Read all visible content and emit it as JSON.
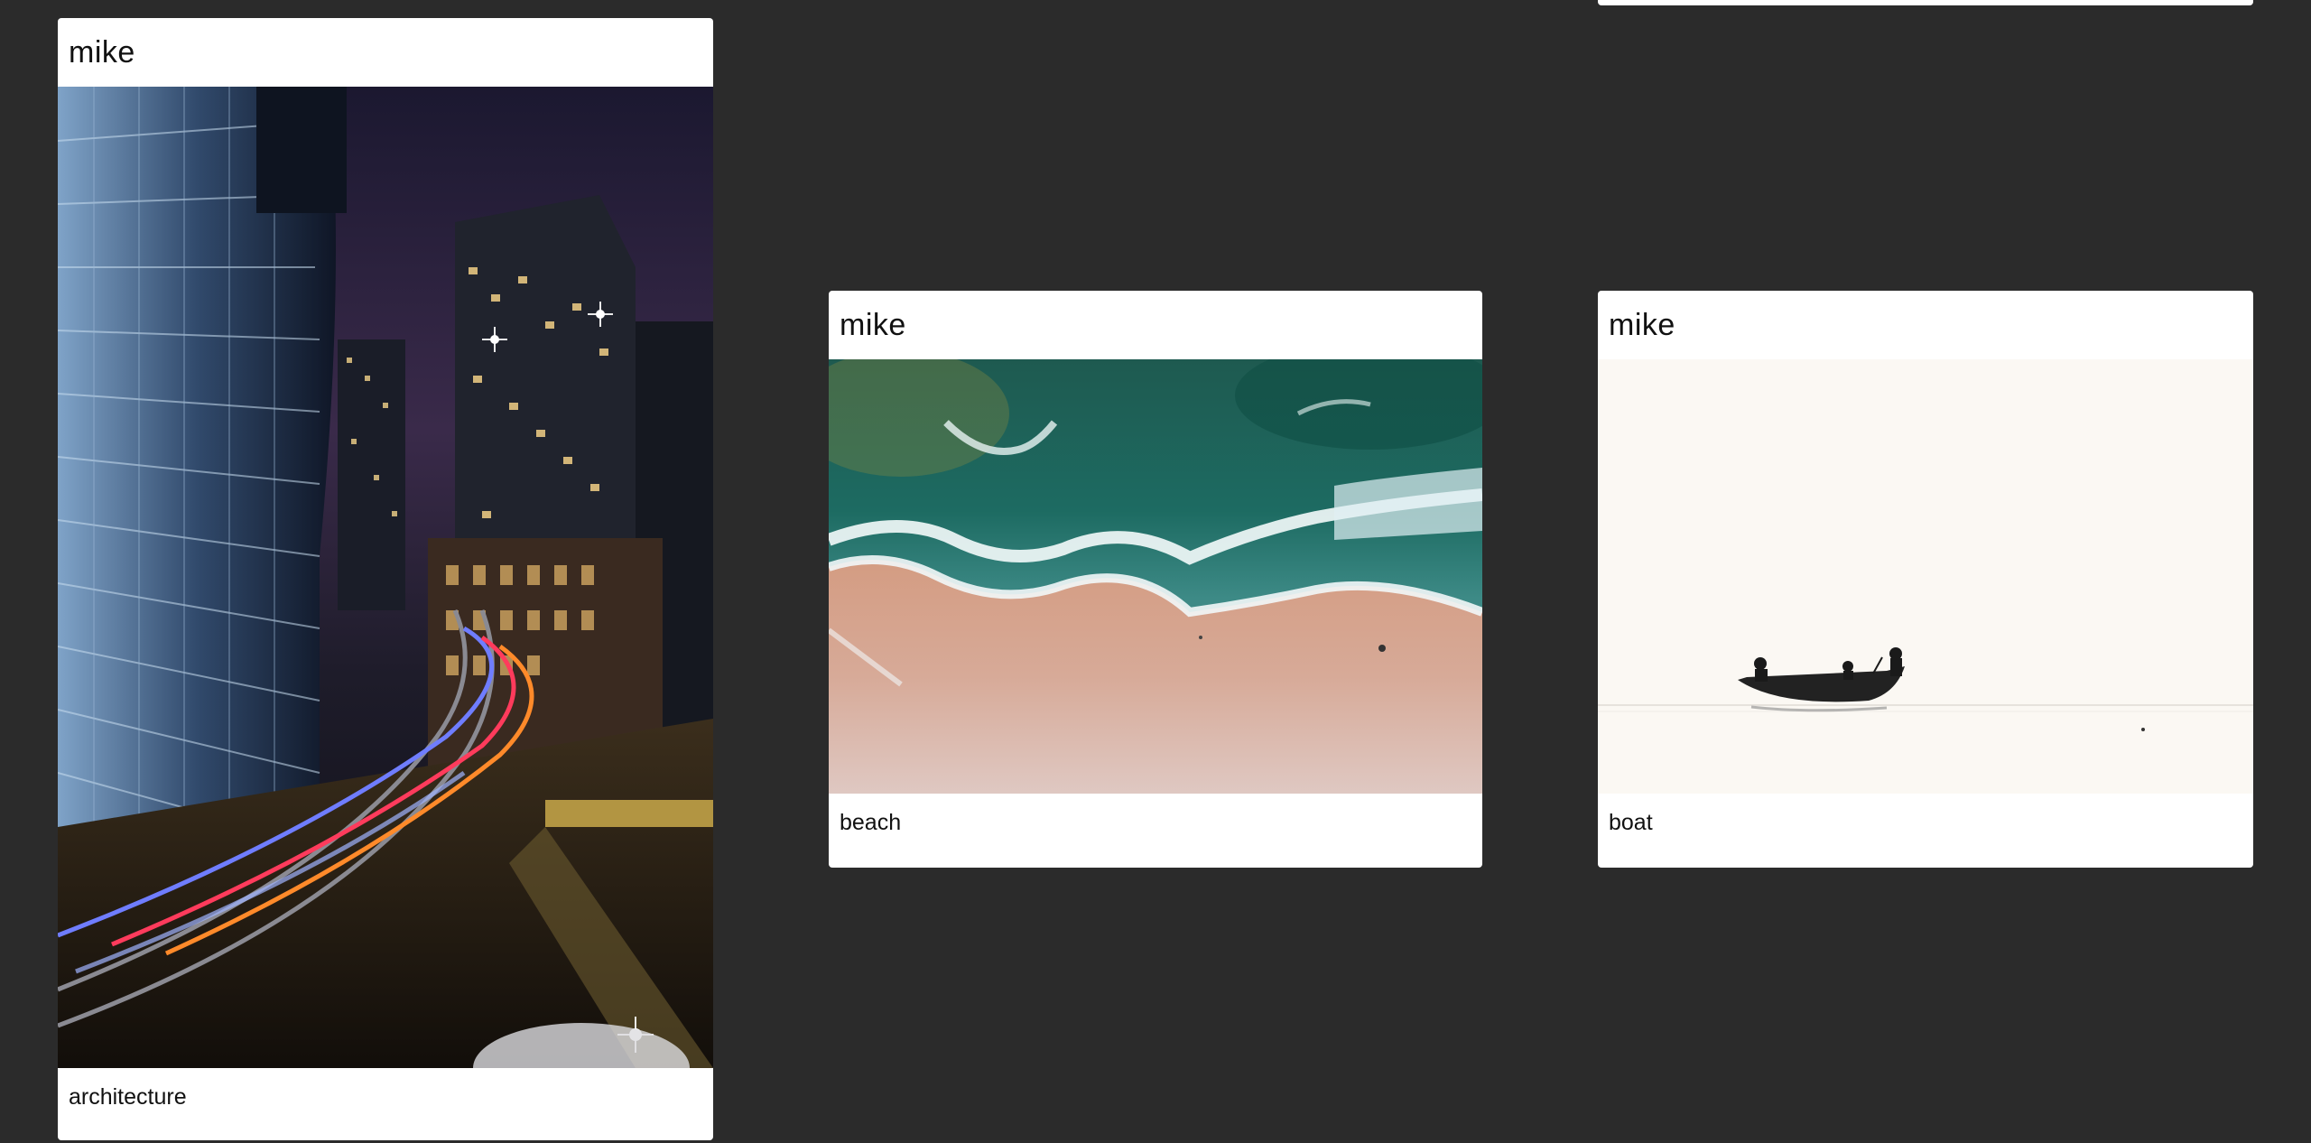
{
  "gallery": {
    "cards": [
      {
        "author": "mike",
        "caption": "architecture",
        "image": "city-night-light-trails-photo"
      },
      {
        "author": "mike",
        "caption": "beach",
        "image": "aerial-beach-waves-photo"
      },
      {
        "author": "mike",
        "caption": "boat",
        "image": "boat-minimal-photo"
      }
    ]
  },
  "colors": {
    "background": "#2b2b2b",
    "card": "#ffffff",
    "text": "#111111"
  }
}
